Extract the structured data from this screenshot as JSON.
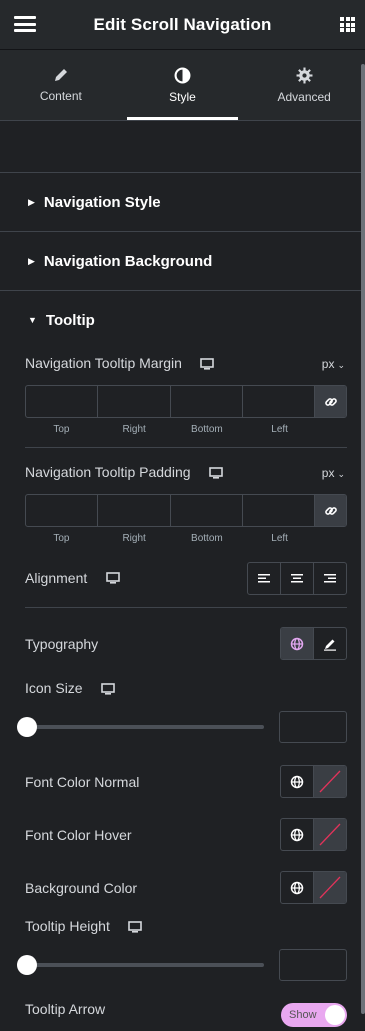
{
  "header": {
    "title": "Edit Scroll Navigation"
  },
  "tabs": [
    {
      "label": "Content",
      "icon": "pencil-icon"
    },
    {
      "label": "Style",
      "icon": "contrast-icon",
      "active": true
    },
    {
      "label": "Advanced",
      "icon": "gear-icon"
    }
  ],
  "sections": {
    "navigation_style": "Navigation Style",
    "navigation_background": "Navigation Background",
    "tooltip": "Tooltip"
  },
  "tooltip_controls": {
    "margin": {
      "label": "Navigation Tooltip Margin",
      "unit": "px",
      "top": "Top",
      "right": "Right",
      "bottom": "Bottom",
      "left": "Left"
    },
    "padding": {
      "label": "Navigation Tooltip Padding",
      "unit": "px",
      "top": "Top",
      "right": "Right",
      "bottom": "Bottom",
      "left": "Left"
    },
    "alignment": {
      "label": "Alignment",
      "options": [
        "align-left-icon",
        "align-center-icon",
        "align-right-icon"
      ]
    },
    "typography": {
      "label": "Typography"
    },
    "icon_size": {
      "label": "Icon Size",
      "value_fraction": 0
    },
    "font_color_normal": {
      "label": "Font Color Normal"
    },
    "font_color_hover": {
      "label": "Font Color Hover"
    },
    "background_color": {
      "label": "Background Color"
    },
    "tooltip_height": {
      "label": "Tooltip Height",
      "value_fraction": 0
    },
    "tooltip_arrow": {
      "label": "Tooltip Arrow",
      "toggle_text": "Show"
    }
  },
  "colors": {
    "accent_toggle": "#e9a8f0",
    "panel_bg": "#1f2124",
    "header_bg": "#26292c"
  }
}
